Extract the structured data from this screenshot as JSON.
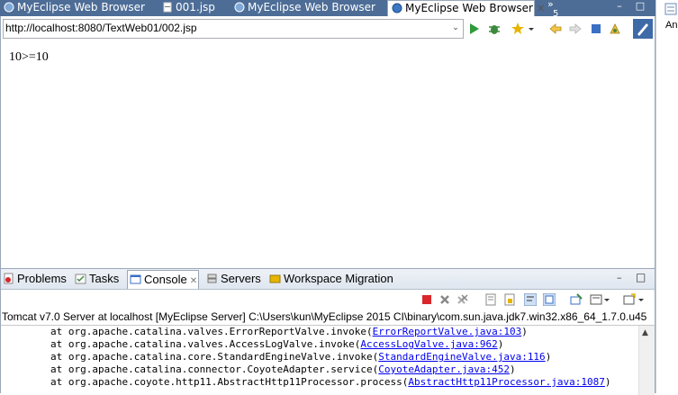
{
  "editor_tabs": [
    {
      "label": "MyEclipse Web Browser",
      "active": false
    },
    {
      "label": "001.jsp",
      "active": false
    },
    {
      "label": "MyEclipse Web Browser",
      "active": false
    },
    {
      "label": "MyEclipse Web Browser",
      "active": true
    }
  ],
  "overflow_count": "5",
  "window_controls": {
    "minimize": "–",
    "maximize": "□"
  },
  "browser": {
    "url": "http://localhost:8080/TextWeb01/002.jsp",
    "dropdown_glyph": "⌄"
  },
  "page": {
    "text": "10>=10"
  },
  "right_strip_label": "An",
  "panel": {
    "tabs": [
      {
        "label": "Problems",
        "active": false
      },
      {
        "label": "Tasks",
        "active": false
      },
      {
        "label": "Console",
        "active": true
      },
      {
        "label": "Servers",
        "active": false
      },
      {
        "label": "Workspace Migration",
        "active": false
      }
    ],
    "console_title": "Tomcat v7.0 Server at localhost [MyEclipse Server] C:\\Users\\kun\\MyEclipse 2015 CI\\binary\\com.sun.java.jdk7.win32.x86_64_1.7.0.u45",
    "lines": [
      {
        "prefix": "at org.apache.catalina.valves.ErrorReportValve.invoke(",
        "link": "ErrorReportValve.java:103",
        "suffix": ")"
      },
      {
        "prefix": "at org.apache.catalina.valves.AccessLogValve.invoke(",
        "link": "AccessLogValve.java:962",
        "suffix": ")"
      },
      {
        "prefix": "at org.apache.catalina.core.StandardEngineValve.invoke(",
        "link": "StandardEngineValve.java:116",
        "suffix": ")"
      },
      {
        "prefix": "at org.apache.catalina.connector.CoyoteAdapter.service(",
        "link": "CoyoteAdapter.java:452",
        "suffix": ")"
      },
      {
        "prefix": "at org.apache.coyote.http11.AbstractHttp11Processor.process(",
        "link": "AbstractHttp11Processor.java:1087",
        "suffix": ")"
      }
    ]
  },
  "colors": {
    "tab_strip": "#4d6d97",
    "link": "#0000ee",
    "terminate_red": "#d9262b"
  }
}
